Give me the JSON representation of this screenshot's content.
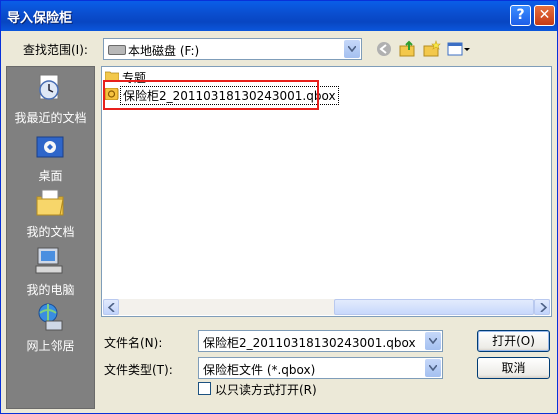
{
  "window": {
    "title": "导入保险柜"
  },
  "toolbar": {
    "look_in_label": "查找范围(I):",
    "look_in_value": "本地磁盘 (F:)"
  },
  "places": [
    {
      "label": "我最近的文档"
    },
    {
      "label": "桌面"
    },
    {
      "label": "我的文档"
    },
    {
      "label": "我的电脑"
    },
    {
      "label": "网上邻居"
    }
  ],
  "files": [
    {
      "name": "专题",
      "kind": "folder"
    },
    {
      "name": "保险柜2_20110318130243001.qbox",
      "kind": "qbox",
      "selected": true
    }
  ],
  "form": {
    "filename_label": "文件名(N):",
    "filename_value": "保险柜2_20110318130243001.qbox",
    "filetype_label": "文件类型(T):",
    "filetype_value": "保险柜文件 (*.qbox)",
    "open_label": "打开(O)",
    "cancel_label": "取消",
    "readonly_label": "以只读方式打开(R)"
  },
  "colors": {
    "titlebar": "#0a5ee8",
    "highlight": "#e8201c",
    "places_bg": "#808080"
  }
}
